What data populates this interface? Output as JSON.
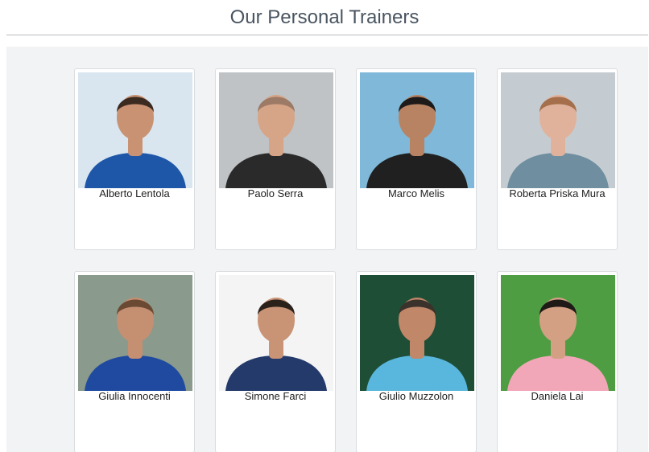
{
  "page": {
    "title": "Our Personal Trainers"
  },
  "trainers": [
    {
      "name": "Alberto Lentola",
      "bg": "#d9e6f0",
      "shirt": "#1e57a8",
      "skin": "#c99273",
      "hair": "#3a2a20"
    },
    {
      "name": "Paolo Serra",
      "bg": "#bfc3c6",
      "shirt": "#2a2a2a",
      "skin": "#d6a486",
      "hair": "#9c7a66"
    },
    {
      "name": "Marco Melis",
      "bg": "#7fb8d8",
      "shirt": "#202020",
      "skin": "#b88363",
      "hair": "#1d1a19"
    },
    {
      "name": "Roberta Priska Mura",
      "bg": "#c5ccd1",
      "shirt": "#6f8ea0",
      "skin": "#e0b29b",
      "hair": "#a56f4b"
    },
    {
      "name": "Giulia Innocenti",
      "bg": "#8a9a8c",
      "shirt": "#1f4aa0",
      "skin": "#c58f72",
      "hair": "#6b4a33"
    },
    {
      "name": "Simone Farci",
      "bg": "#f4f4f4",
      "shirt": "#233a6b",
      "skin": "#c99476",
      "hair": "#2a211b"
    },
    {
      "name": "Giulio Muzzolon",
      "bg": "#1f4e37",
      "shirt": "#59b7de",
      "skin": "#c08768",
      "hair": "#3b322c"
    },
    {
      "name": "Daniela Lai",
      "bg": "#4e9d43",
      "shirt": "#f2a7b8",
      "skin": "#d4a083",
      "hair": "#1f1a18"
    }
  ]
}
